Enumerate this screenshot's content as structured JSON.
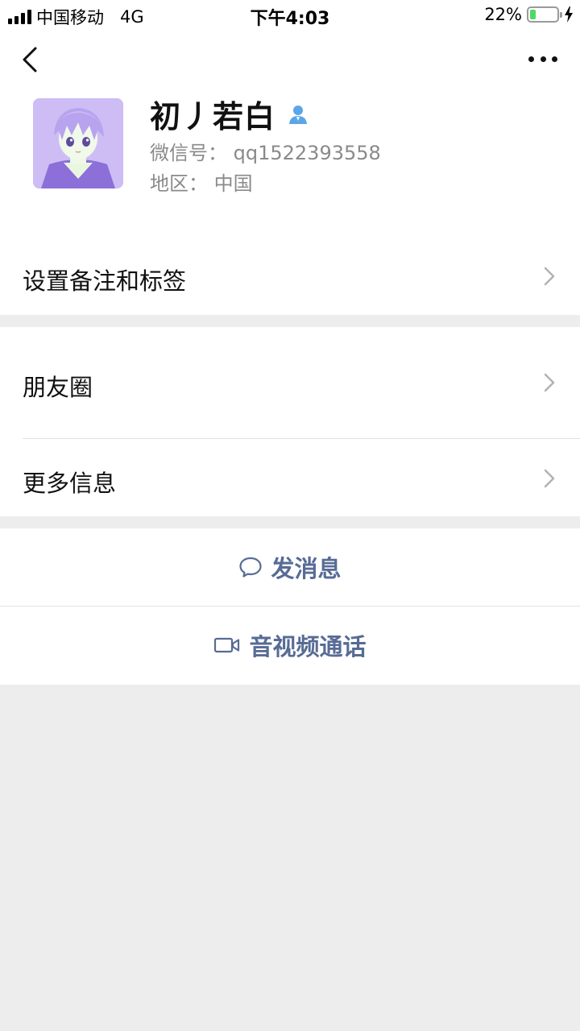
{
  "status_bar": {
    "carrier": "中国移动",
    "network": "4G",
    "time": "下午4:03",
    "battery_percent": "22%",
    "battery_level": 0.22,
    "icons": [
      "signal-icon",
      "battery-icon",
      "charging-bolt-icon"
    ]
  },
  "nav": {
    "back_icon": "chevron-left-icon",
    "more_icon": "more-dots-icon"
  },
  "profile": {
    "name": "初丿若白",
    "gender_icon": "person-male-icon",
    "wechat_id": "微信号：  qq1522393558",
    "region": "地区：  中国"
  },
  "menu": {
    "remark_tags": "设置备注和标签",
    "moments": "朋友圈",
    "more_info": "更多信息"
  },
  "actions": {
    "send_message": "发消息",
    "video_call": "音视频通话"
  },
  "colors": {
    "accent_link": "#576b95",
    "background": "#ededed",
    "battery_fill": "#4cd964",
    "gender_icon": "#5aa6e8"
  }
}
